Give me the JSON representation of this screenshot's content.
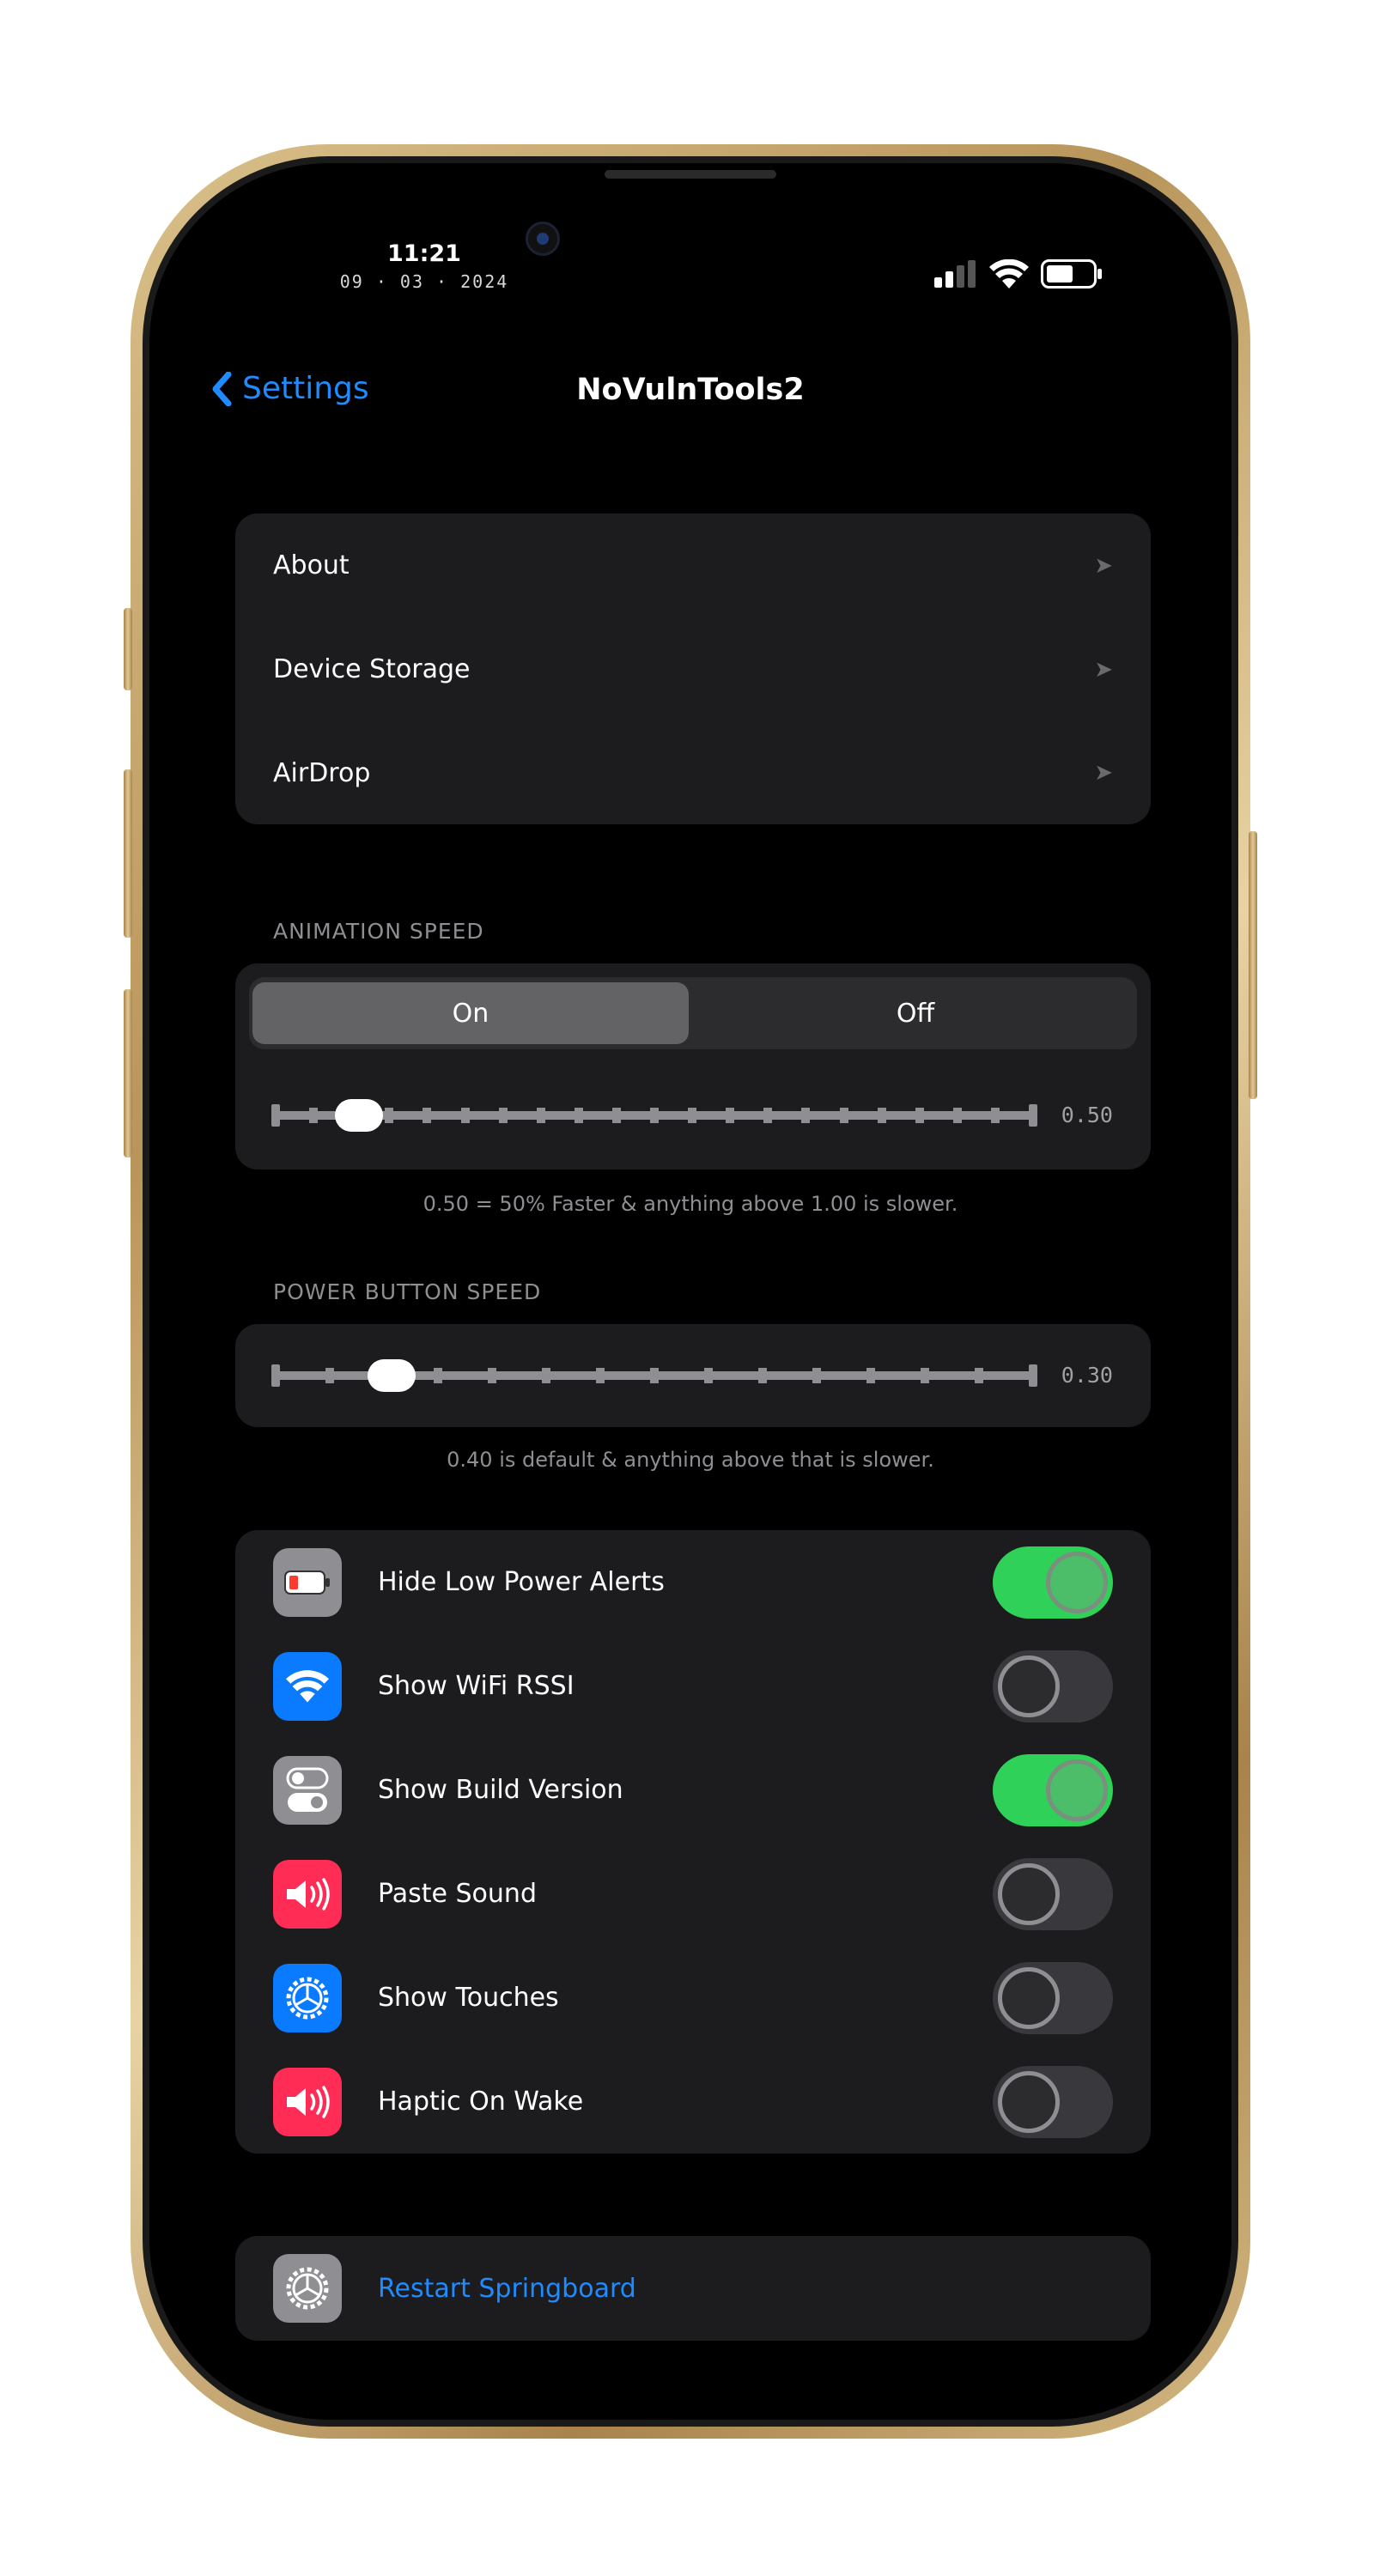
{
  "status_bar": {
    "time": "11:21",
    "date": "09 · 03 · 2024"
  },
  "nav": {
    "back_label": "Settings",
    "title": "NoVulnTools2"
  },
  "links": [
    {
      "label": "About"
    },
    {
      "label": "Device Storage"
    },
    {
      "label": "AirDrop"
    }
  ],
  "animation_speed": {
    "header": "ANIMATION SPEED",
    "segment_on": "On",
    "segment_off": "Off",
    "selected_segment": "On",
    "value_text": "0.50",
    "footnote": "0.50 = 50% Faster & anything above 1.00 is slower."
  },
  "power_button_speed": {
    "header": "POWER BUTTON SPEED",
    "value_text": "0.30",
    "footnote": "0.40 is default & anything above that is slower."
  },
  "toggles": [
    {
      "label": "Hide Low Power Alerts",
      "icon": "battery-icon",
      "icon_bg": "#8e8e93",
      "on": true
    },
    {
      "label": "Show WiFi RSSI",
      "icon": "wifi-icon",
      "icon_bg": "#0a7aff",
      "on": false
    },
    {
      "label": "Show Build Version",
      "icon": "switches-icon",
      "icon_bg": "#8e8e93",
      "on": true
    },
    {
      "label": "Paste Sound",
      "icon": "speaker-icon",
      "icon_bg": "#ff2d55",
      "on": false
    },
    {
      "label": "Show Touches",
      "icon": "gear-icon",
      "icon_bg": "#0a7aff",
      "on": false
    },
    {
      "label": "Haptic On Wake",
      "icon": "speaker-icon",
      "icon_bg": "#ff2d55",
      "on": false
    }
  ],
  "restart": {
    "label": "Restart Springboard",
    "icon": "gear-icon"
  },
  "colors": {
    "accent": "#1f8bff",
    "toggle_on": "#30d158",
    "frame_gold": "#c9a96a"
  }
}
